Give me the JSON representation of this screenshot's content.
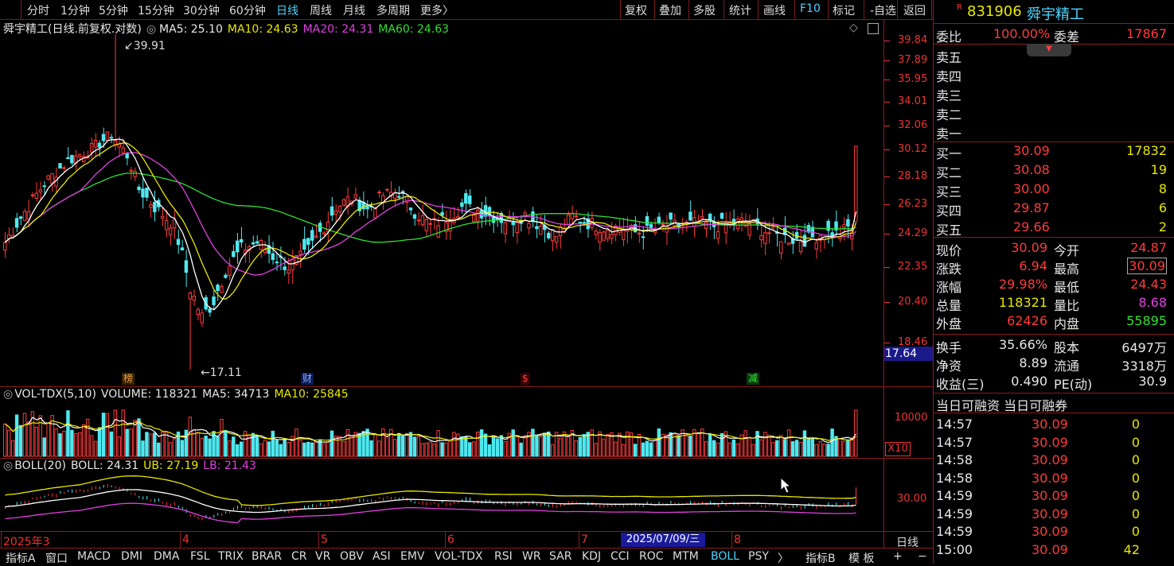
{
  "topbar": {
    "left_items": [
      "分时",
      "1分钟",
      "5分钟",
      "15分钟",
      "30分钟",
      "60分钟",
      "日线",
      "周线",
      "月线",
      "多周期",
      "更多〉"
    ],
    "active_item": "日线",
    "right_items": [
      "复权",
      "叠加",
      "多股",
      "统计",
      "画线",
      "F10",
      "标记",
      "-自选",
      "返回"
    ]
  },
  "main_chart": {
    "title": "舜宇精工(日线.前复权.对数)",
    "ma5": "MA5: 25.10",
    "ma10": "MA10: 24.63",
    "ma20": "MA20: 24.31",
    "ma60": "MA60: 24.63",
    "high_label": "39.91",
    "low_label": "17.11",
    "y_labels": [
      "39.84",
      "37.89",
      "35.95",
      "34.01",
      "32.06",
      "30.12",
      "28.18",
      "26.23",
      "24.29",
      "22.35",
      "20.40",
      "18.46"
    ],
    "price_box": "17.64",
    "markers": [
      "榜",
      "财",
      "$",
      "减"
    ]
  },
  "volume_chart": {
    "title": "VOL-TDX(5,10)",
    "volume": "VOLUME: 118321",
    "ma5": "MA5: 34713",
    "ma10": "MA10: 25845",
    "y_label": "10000",
    "unit": "X10"
  },
  "boll_chart": {
    "title": "BOLL(20)",
    "boll": "BOLL: 24.31",
    "ub": "UB: 27.19",
    "lb": "LB: 21.43",
    "y_label": "30.00"
  },
  "date_axis": {
    "labels": [
      "2025年3",
      "4",
      "5",
      "6",
      "7",
      "8"
    ],
    "cursor_date": "2025/07/09/三",
    "period_label": "日线"
  },
  "bottombar": {
    "items": [
      "指标A",
      "窗口",
      "MACD",
      "DMI",
      "DMA",
      "FSL",
      "TRIX",
      "BRAR",
      "CR",
      "VR",
      "OBV",
      "ASI",
      "EMV",
      "VOL-TDX",
      "RSI",
      "WR",
      "SAR",
      "KDJ",
      "CCI",
      "ROC",
      "MTM",
      "BOLL",
      "PSY",
      "〉"
    ],
    "active_item": "BOLL",
    "right_items": [
      "指标B",
      "模 板",
      "+",
      "−"
    ]
  },
  "quote_panel": {
    "r_badge": "R",
    "code": "831906",
    "name": "舜宇精工",
    "weibi_label": "委比",
    "weibi_value": "100.00%",
    "weicha_label": "委差",
    "weicha_value": "17867",
    "sell_labels": [
      "卖五",
      "卖四",
      "卖三",
      "卖二",
      "卖一"
    ],
    "buy": [
      {
        "label": "买一",
        "price": "30.09",
        "vol": "17832"
      },
      {
        "label": "买二",
        "price": "30.08",
        "vol": "19"
      },
      {
        "label": "买三",
        "price": "30.00",
        "vol": "8"
      },
      {
        "label": "买四",
        "price": "29.87",
        "vol": "6"
      },
      {
        "label": "买五",
        "price": "29.66",
        "vol": "2"
      }
    ],
    "stats": [
      {
        "l1": "现价",
        "v1": "30.09",
        "l2": "今开",
        "v2": "24.87"
      },
      {
        "l1": "涨跌",
        "v1": "6.94",
        "l2": "最高",
        "v2": "30.09"
      },
      {
        "l1": "涨幅",
        "v1": "29.98%",
        "l2": "最低",
        "v2": "24.43"
      },
      {
        "l1": "总量",
        "v1": "118321",
        "l2": "量比",
        "v2": "8.68"
      },
      {
        "l1": "外盘",
        "v1": "62426",
        "l2": "内盘",
        "v2": "55895"
      }
    ],
    "stats2": [
      {
        "l1": "换手",
        "v1": "35.66%",
        "l2": "股本",
        "v2": "6497万"
      },
      {
        "l1": "净资",
        "v1": "8.89",
        "l2": "流通",
        "v2": "3318万"
      },
      {
        "l1": "收益(三)",
        "v1": "0.490",
        "l2": "PE(动)",
        "v2": "30.9"
      }
    ],
    "margin_header": "当日可融资 当日可融券",
    "ticks": [
      {
        "time": "14:57",
        "price": "30.09",
        "vol": "0"
      },
      {
        "time": "14:57",
        "price": "30.09",
        "vol": "0"
      },
      {
        "time": "14:58",
        "price": "30.09",
        "vol": "0"
      },
      {
        "time": "14:58",
        "price": "30.09",
        "vol": "0"
      },
      {
        "time": "14:59",
        "price": "30.09",
        "vol": "0"
      },
      {
        "time": "14:59",
        "price": "30.09",
        "vol": "0"
      },
      {
        "time": "14:59",
        "price": "30.09",
        "vol": "0"
      },
      {
        "time": "15:00",
        "price": "30.09",
        "vol": "42"
      }
    ]
  },
  "colors": {
    "up": "#ff3b3b",
    "down": "#4fe8f0",
    "ma5": "#ffffff",
    "ma10": "#e8e800",
    "ma20": "#e040e0",
    "ma60": "#2fe22f",
    "grid": "#8a1c1c"
  }
}
